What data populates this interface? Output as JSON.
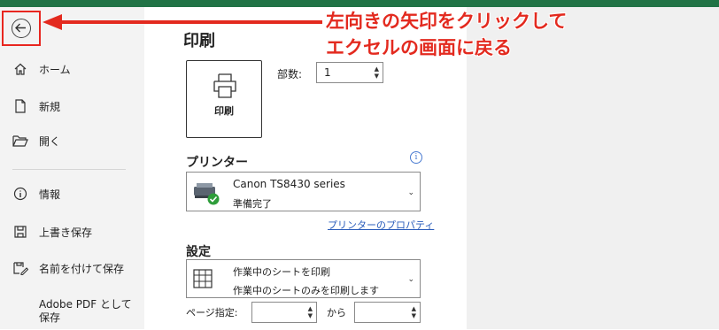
{
  "nav": {
    "back_label": "戻る",
    "items": [
      {
        "label": "ホーム",
        "icon": "home-icon"
      },
      {
        "label": "新規",
        "icon": "new-document-icon"
      },
      {
        "label": "開く",
        "icon": "open-folder-icon"
      },
      {
        "label": "情報",
        "icon": "info-icon"
      },
      {
        "label": "上書き保存",
        "icon": "save-icon"
      },
      {
        "label": "名前を付けて保存",
        "icon": "save-as-icon"
      },
      {
        "label": "Adobe PDF として",
        "label2": "保存"
      }
    ]
  },
  "print": {
    "title": "印刷",
    "button_label": "印刷",
    "copies_label": "部数:",
    "copies_value": "1"
  },
  "printer": {
    "section_label": "プリンター",
    "name": "Canon TS8430 series",
    "status": "準備完了",
    "properties_link": "プリンターのプロパティ"
  },
  "settings": {
    "section_label": "設定",
    "scope_title": "作業中のシートを印刷",
    "scope_desc": "作業中のシートのみを印刷します",
    "page_label": "ページ指定:",
    "to_label": "から"
  },
  "annotation": {
    "line1": "左向きの矢印をクリックして",
    "line2": "エクセルの画面に戻る",
    "color": "#e32a1f"
  },
  "colors": {
    "excel_green": "#217346",
    "sidebar_bg": "#f3f3f3",
    "link_blue": "#2b5dbb"
  }
}
